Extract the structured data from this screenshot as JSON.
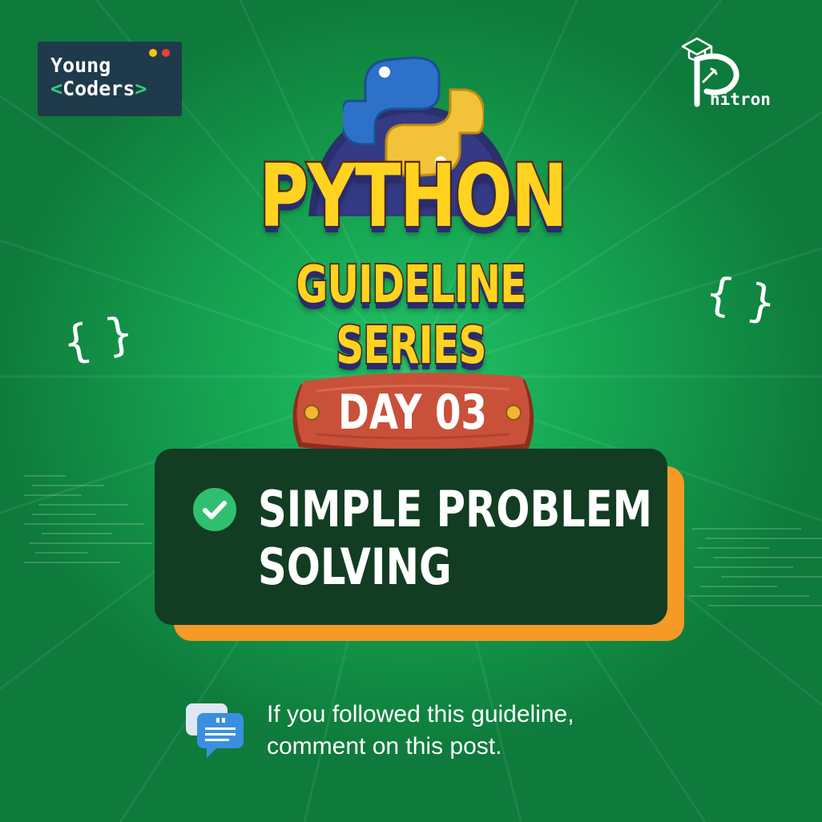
{
  "brand": {
    "young_coders_line1": "Young",
    "young_coders_open": "<",
    "young_coders_word": "Coders",
    "young_coders_close": ">",
    "phitron_text": "hitron"
  },
  "title": {
    "main": "PYTHON",
    "sub": "GUIDELINE SERIES"
  },
  "day": {
    "label": "DAY 03"
  },
  "topic": {
    "line1": "SIMPLE PROBLEM",
    "line2": "SOLVING"
  },
  "footer": {
    "line1": "If you followed this guideline,",
    "line2": "comment on this post."
  },
  "decor": {
    "brace_left": "{ }",
    "brace_right": "{ }"
  },
  "icons": {
    "python": "python-logo-icon",
    "check": "check-circle-icon",
    "comment": "comment-bubble-icon",
    "graduation": "graduation-cap-icon"
  },
  "colors": {
    "background": "#16a552",
    "title_yellow": "#ffd31f",
    "card_dark": "#123d22",
    "card_shadow": "#f59a26",
    "plank_red": "#c0452e",
    "badge": "#1f3a4a",
    "accent_green": "#31d07a"
  }
}
